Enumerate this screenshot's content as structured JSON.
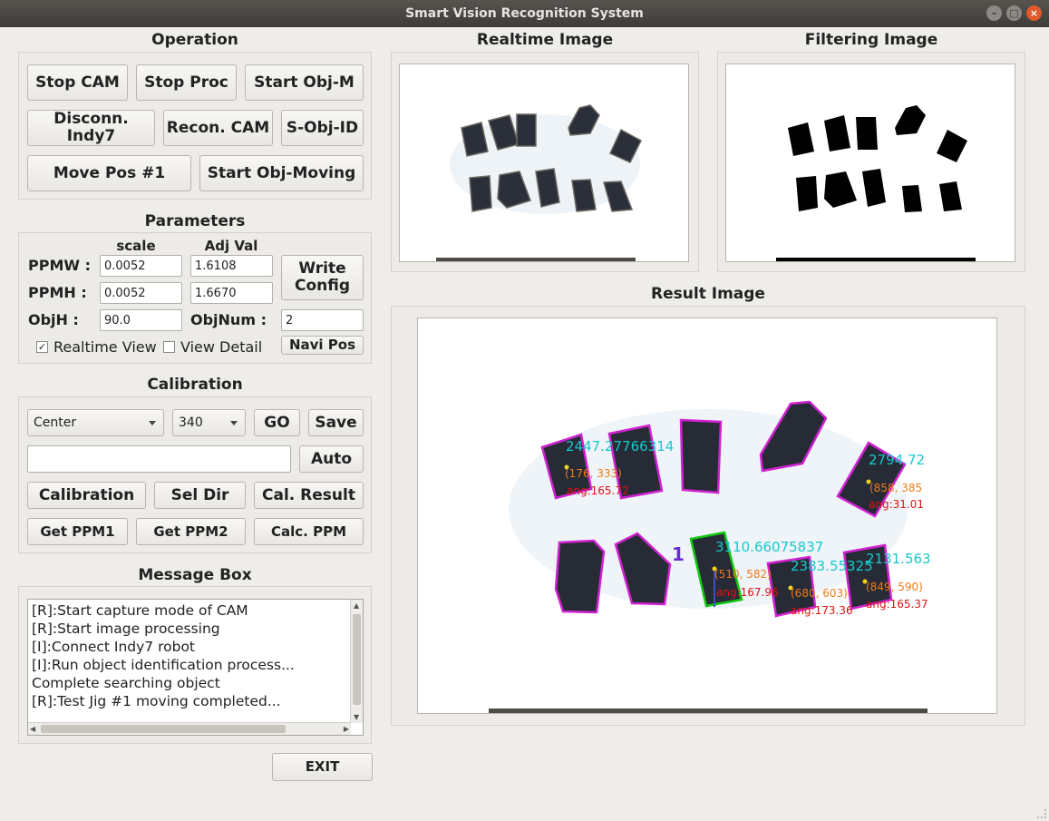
{
  "window": {
    "title": "Smart Vision Recognition System"
  },
  "operation": {
    "title": "Operation",
    "buttons": {
      "stop_cam": "Stop CAM",
      "stop_proc": "Stop Proc",
      "start_obj_m": "Start Obj-M",
      "disconn": "Disconn. Indy7",
      "recon_cam": "Recon. CAM",
      "s_obj_id": "S-Obj-ID",
      "move_pos": "Move Pos #1",
      "start_obj_moving": "Start Obj-Moving"
    }
  },
  "parameters": {
    "title": "Parameters",
    "col_scale": "scale",
    "col_adj": "Adj Val",
    "ppmw_label": "PPMW :",
    "ppmh_label": "PPMH :",
    "objh_label": "ObjH :",
    "objnum_label": "ObjNum :",
    "ppmw_scale": "0.0052",
    "ppmw_adj": "1.6108",
    "ppmh_scale": "0.0052",
    "ppmh_adj": "1.6670",
    "objh": "90.0",
    "objnum": "2",
    "write_config": "Write\nConfig",
    "navi_pos": "Navi Pos",
    "realtime_view": "Realtime View",
    "realtime_view_checked": true,
    "view_detail": "View Detail",
    "view_detail_checked": false
  },
  "calibration": {
    "title": "Calibration",
    "position_select": "Center",
    "value_select": "340",
    "go": "GO",
    "save": "Save",
    "auto": "Auto",
    "text_input": "",
    "calibration": "Calibration",
    "sel_dir": "Sel Dir",
    "cal_result": "Cal. Result",
    "get_ppm1": "Get PPM1",
    "get_ppm2": "Get PPM2",
    "calc_ppm": "Calc. PPM"
  },
  "message_box": {
    "title": "Message Box",
    "lines": [
      "[R]:Start capture mode of CAM",
      "[R]:Start image processing",
      "[I]:Connect Indy7 robot",
      "[I]:Run object identification process...",
      "Complete searching object",
      "[R]:Test Jig #1 moving completed..."
    ]
  },
  "exit_label": "EXIT",
  "images": {
    "realtime_title": "Realtime Image",
    "filtering_title": "Filtering Image",
    "result_title": "Result Image"
  },
  "result_overlay": {
    "labels": [
      {
        "id": "obj1",
        "value": "2447.27766314",
        "coord": "(176, 333)",
        "angle": "ang:165.72"
      },
      {
        "id": "obj2",
        "value": "2794.72",
        "coord": "(858, 385",
        "angle": "ang:31.01"
      },
      {
        "id": "obj3",
        "value": "3110.66075837",
        "coord": "(510, 582)",
        "angle": "ang:167.96"
      },
      {
        "id": "obj4",
        "value": "2383.55325",
        "coord": "(680, 603)",
        "angle": "ang:173.36"
      },
      {
        "id": "obj5",
        "value": "2131.563",
        "coord": "(849, 590)",
        "angle": "ang:165.37"
      }
    ],
    "index_label": "1"
  }
}
